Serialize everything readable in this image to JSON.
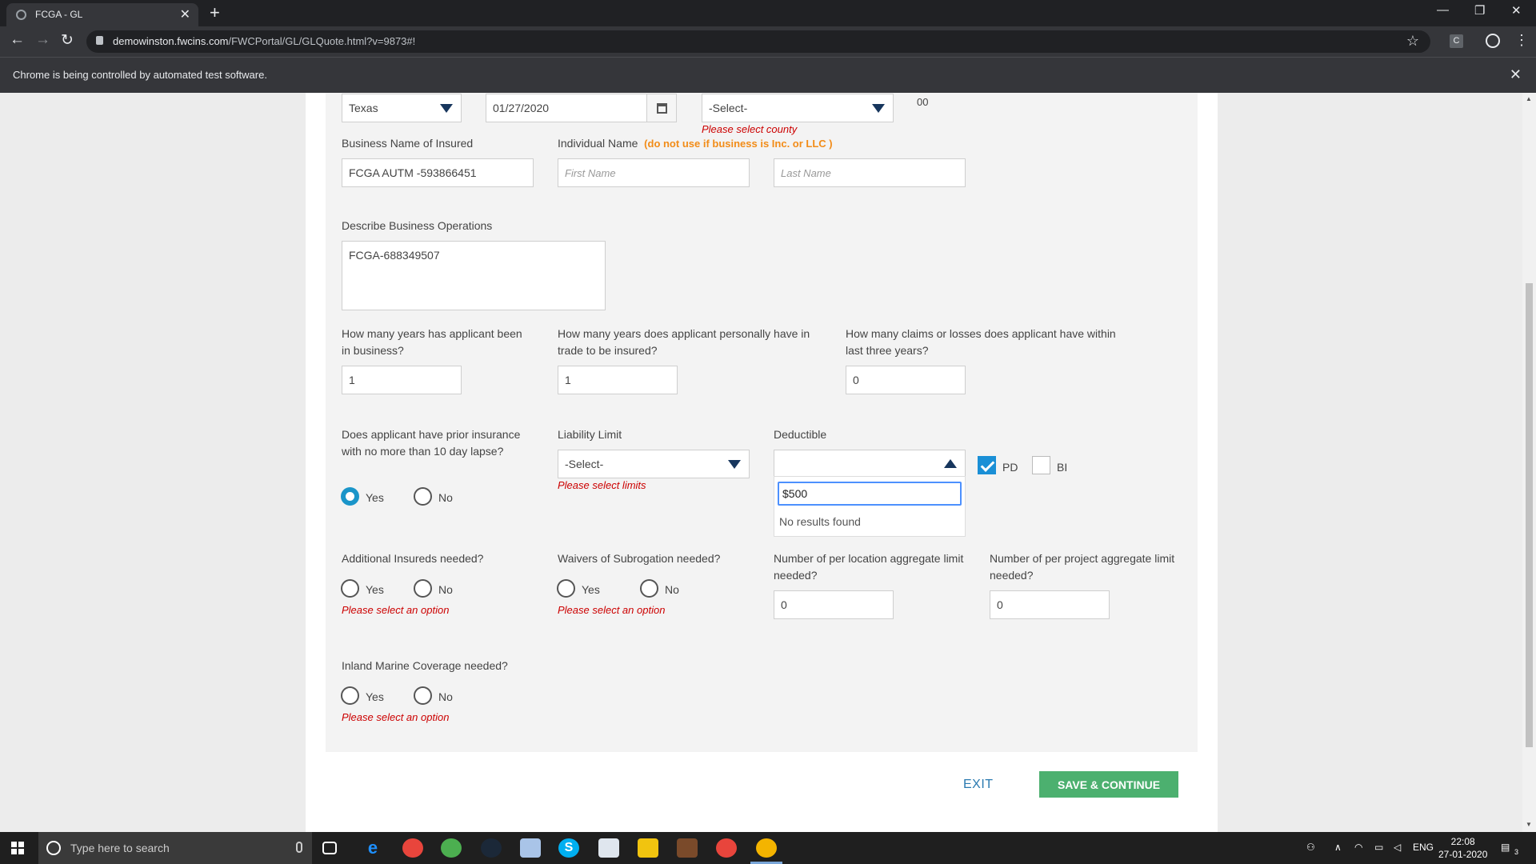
{
  "browser": {
    "tab_title": "FCGA - GL",
    "new_tab": "+",
    "url_host": "demowinston.fwcins.com",
    "url_path": "/FWCPortal/GL/GLQuote.html?v=9873#!",
    "extension_letter": "C",
    "infobar_message": "Chrome is being controlled by automated test software."
  },
  "form": {
    "state_select": "Texas",
    "date": "01/27/2020",
    "county_select": "-Select-",
    "county_error": "Please select county",
    "partial_text": "00",
    "business_name_label": "Business Name of Insured",
    "business_name_value": "FCGA AUTM -593866451",
    "individual_name_label": "Individual Name",
    "individual_name_note": "(do not use if business is Inc. or LLC )",
    "first_name_placeholder": "First Name",
    "last_name_placeholder": "Last Name",
    "operations_label": "Describe Business Operations",
    "operations_value": "FCGA-688349507",
    "years_business_label": "How many years has applicant been in business?",
    "years_business_value": "1",
    "years_trade_label": "How many years does applicant personally have in trade to be insured?",
    "years_trade_value": "1",
    "claims_label": "How many claims or losses does applicant have within last three years?",
    "claims_value": "0",
    "prior_insurance_label": "Does applicant have prior insurance with no more than 10 day lapse?",
    "liability_label": "Liability Limit",
    "liability_select": "-Select-",
    "liability_error": "Please select limits",
    "deductible_label": "Deductible",
    "deductible_search": "$500",
    "deductible_no_results": "No results found",
    "pd_label": "PD",
    "bi_label": "BI",
    "additional_insureds_label": "Additional Insureds needed?",
    "waivers_label": "Waivers of Subrogation needed?",
    "per_location_label": "Number of per location aggregate limit needed?",
    "per_location_value": "0",
    "per_project_label": "Number of per project aggregate limit needed?",
    "per_project_value": "0",
    "inland_marine_label": "Inland Marine Coverage needed?",
    "yes": "Yes",
    "no": "No",
    "option_error": "Please select an option",
    "exit_label": "EXIT",
    "save_label": "SAVE & CONTINUE"
  },
  "taskbar": {
    "search_placeholder": "Type here to search",
    "language": "ENG",
    "time": "22:08",
    "date": "27-01-2020",
    "notification_count": "3"
  }
}
